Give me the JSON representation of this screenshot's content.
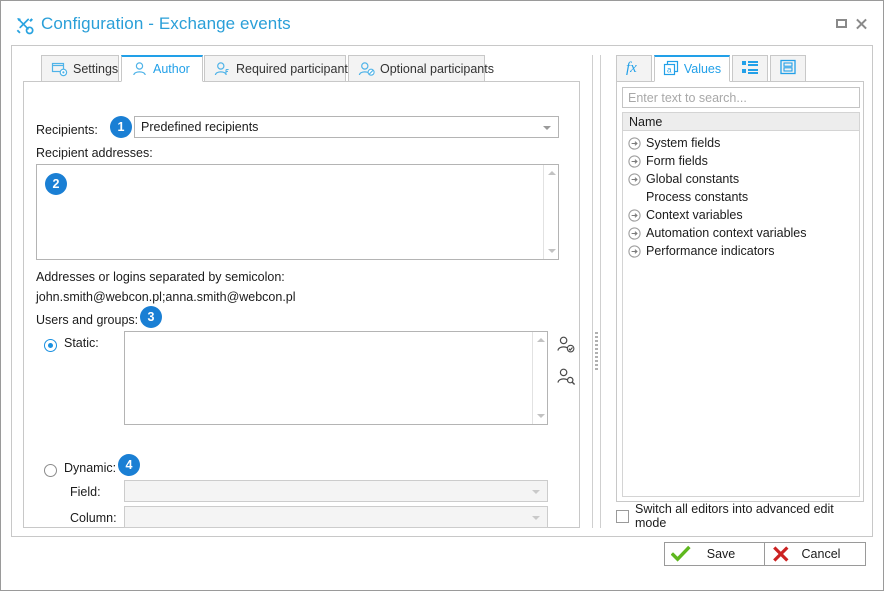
{
  "window": {
    "title": "Configuration - Exchange events",
    "icon": "tools-icon",
    "maximize_label": "Maximize",
    "close_label": "Close"
  },
  "tabs": [
    {
      "label": "Settings",
      "icon": "settings-gear-icon",
      "active": false
    },
    {
      "label": "Author",
      "icon": "user-icon",
      "active": true
    },
    {
      "label": "Required participants",
      "icon": "user-required-icon",
      "active": false
    },
    {
      "label": "Optional participants",
      "icon": "user-optional-icon",
      "active": false
    }
  ],
  "form": {
    "recipients_label": "Recipients:",
    "recipients_value": "Predefined recipients",
    "recipients_badge": "1",
    "recipient_addresses_label": "Recipient addresses:",
    "recipient_addresses_value": "",
    "recipient_addresses_badge": "2",
    "hint_line1": "Addresses or logins separated by semicolon:",
    "hint_line2": "john.smith@webcon.pl;anna.smith@webcon.pl",
    "users_groups_label": "Users and groups:",
    "users_groups_badge": "3",
    "static_label": "Static:",
    "static_value": "",
    "dynamic_label": "Dynamic:",
    "dynamic_badge": "4",
    "field_label": "Field:",
    "field_value": "",
    "column_label": "Column:",
    "column_value": "",
    "picker_icons": [
      "user-check-icon",
      "user-search-icon"
    ]
  },
  "right_panel": {
    "tabs": [
      {
        "label": "",
        "icon": "function-fx-icon",
        "active": false
      },
      {
        "label": "Values",
        "icon": "values-a-icon",
        "active": true
      },
      {
        "label": "",
        "icon": "list-icon",
        "active": false
      },
      {
        "label": "",
        "icon": "form-card-icon",
        "active": false
      }
    ],
    "search_placeholder": "Enter text to search...",
    "search_value": "",
    "column_header": "Name",
    "tree": [
      {
        "label": "System fields",
        "expandable": true
      },
      {
        "label": "Form fields",
        "expandable": true
      },
      {
        "label": "Global constants",
        "expandable": true
      },
      {
        "label": "Process constants",
        "expandable": false
      },
      {
        "label": "Context variables",
        "expandable": true
      },
      {
        "label": "Automation context variables",
        "expandable": true
      },
      {
        "label": "Performance indicators",
        "expandable": true
      }
    ],
    "advanced_checkbox_label": "Switch all editors into advanced edit mode",
    "advanced_checkbox_checked": false
  },
  "footer": {
    "save_label": "Save",
    "cancel_label": "Cancel"
  },
  "colors": {
    "accent": "#22a0e8",
    "badge": "#1a7fd4",
    "save_check": "#5fb81f",
    "cancel_x": "#cc2222",
    "border": "#c8c8c8"
  }
}
